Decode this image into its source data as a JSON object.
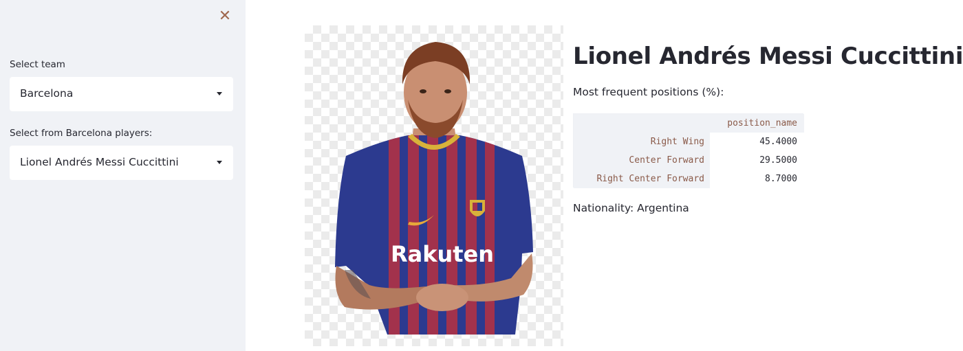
{
  "sidebar": {
    "close_label": "✕",
    "team_label": "Select team",
    "team_value": "Barcelona",
    "player_label": "Select from Barcelona players:",
    "player_value": "Lionel Andrés Messi Cuccittini"
  },
  "main": {
    "player_name": "Lionel Andrés Messi Cuccittini",
    "positions_heading": "Most frequent positions (%):",
    "table": {
      "column": "position_name",
      "rows": [
        {
          "index": "Right Wing",
          "value": "45.4000"
        },
        {
          "index": "Center Forward",
          "value": "29.5000"
        },
        {
          "index": "Right Center Forward",
          "value": "8.7000"
        }
      ]
    },
    "nationality": "Nationality: Argentina",
    "photo": {
      "shirt_sponsor": "Rakuten"
    }
  },
  "colors": {
    "sidebar_bg": "#f0f2f6",
    "accent_close": "#a0684f",
    "index_text": "#8a5a49",
    "shirt_blue": "#2c3a8f",
    "shirt_red": "#a2324c"
  }
}
